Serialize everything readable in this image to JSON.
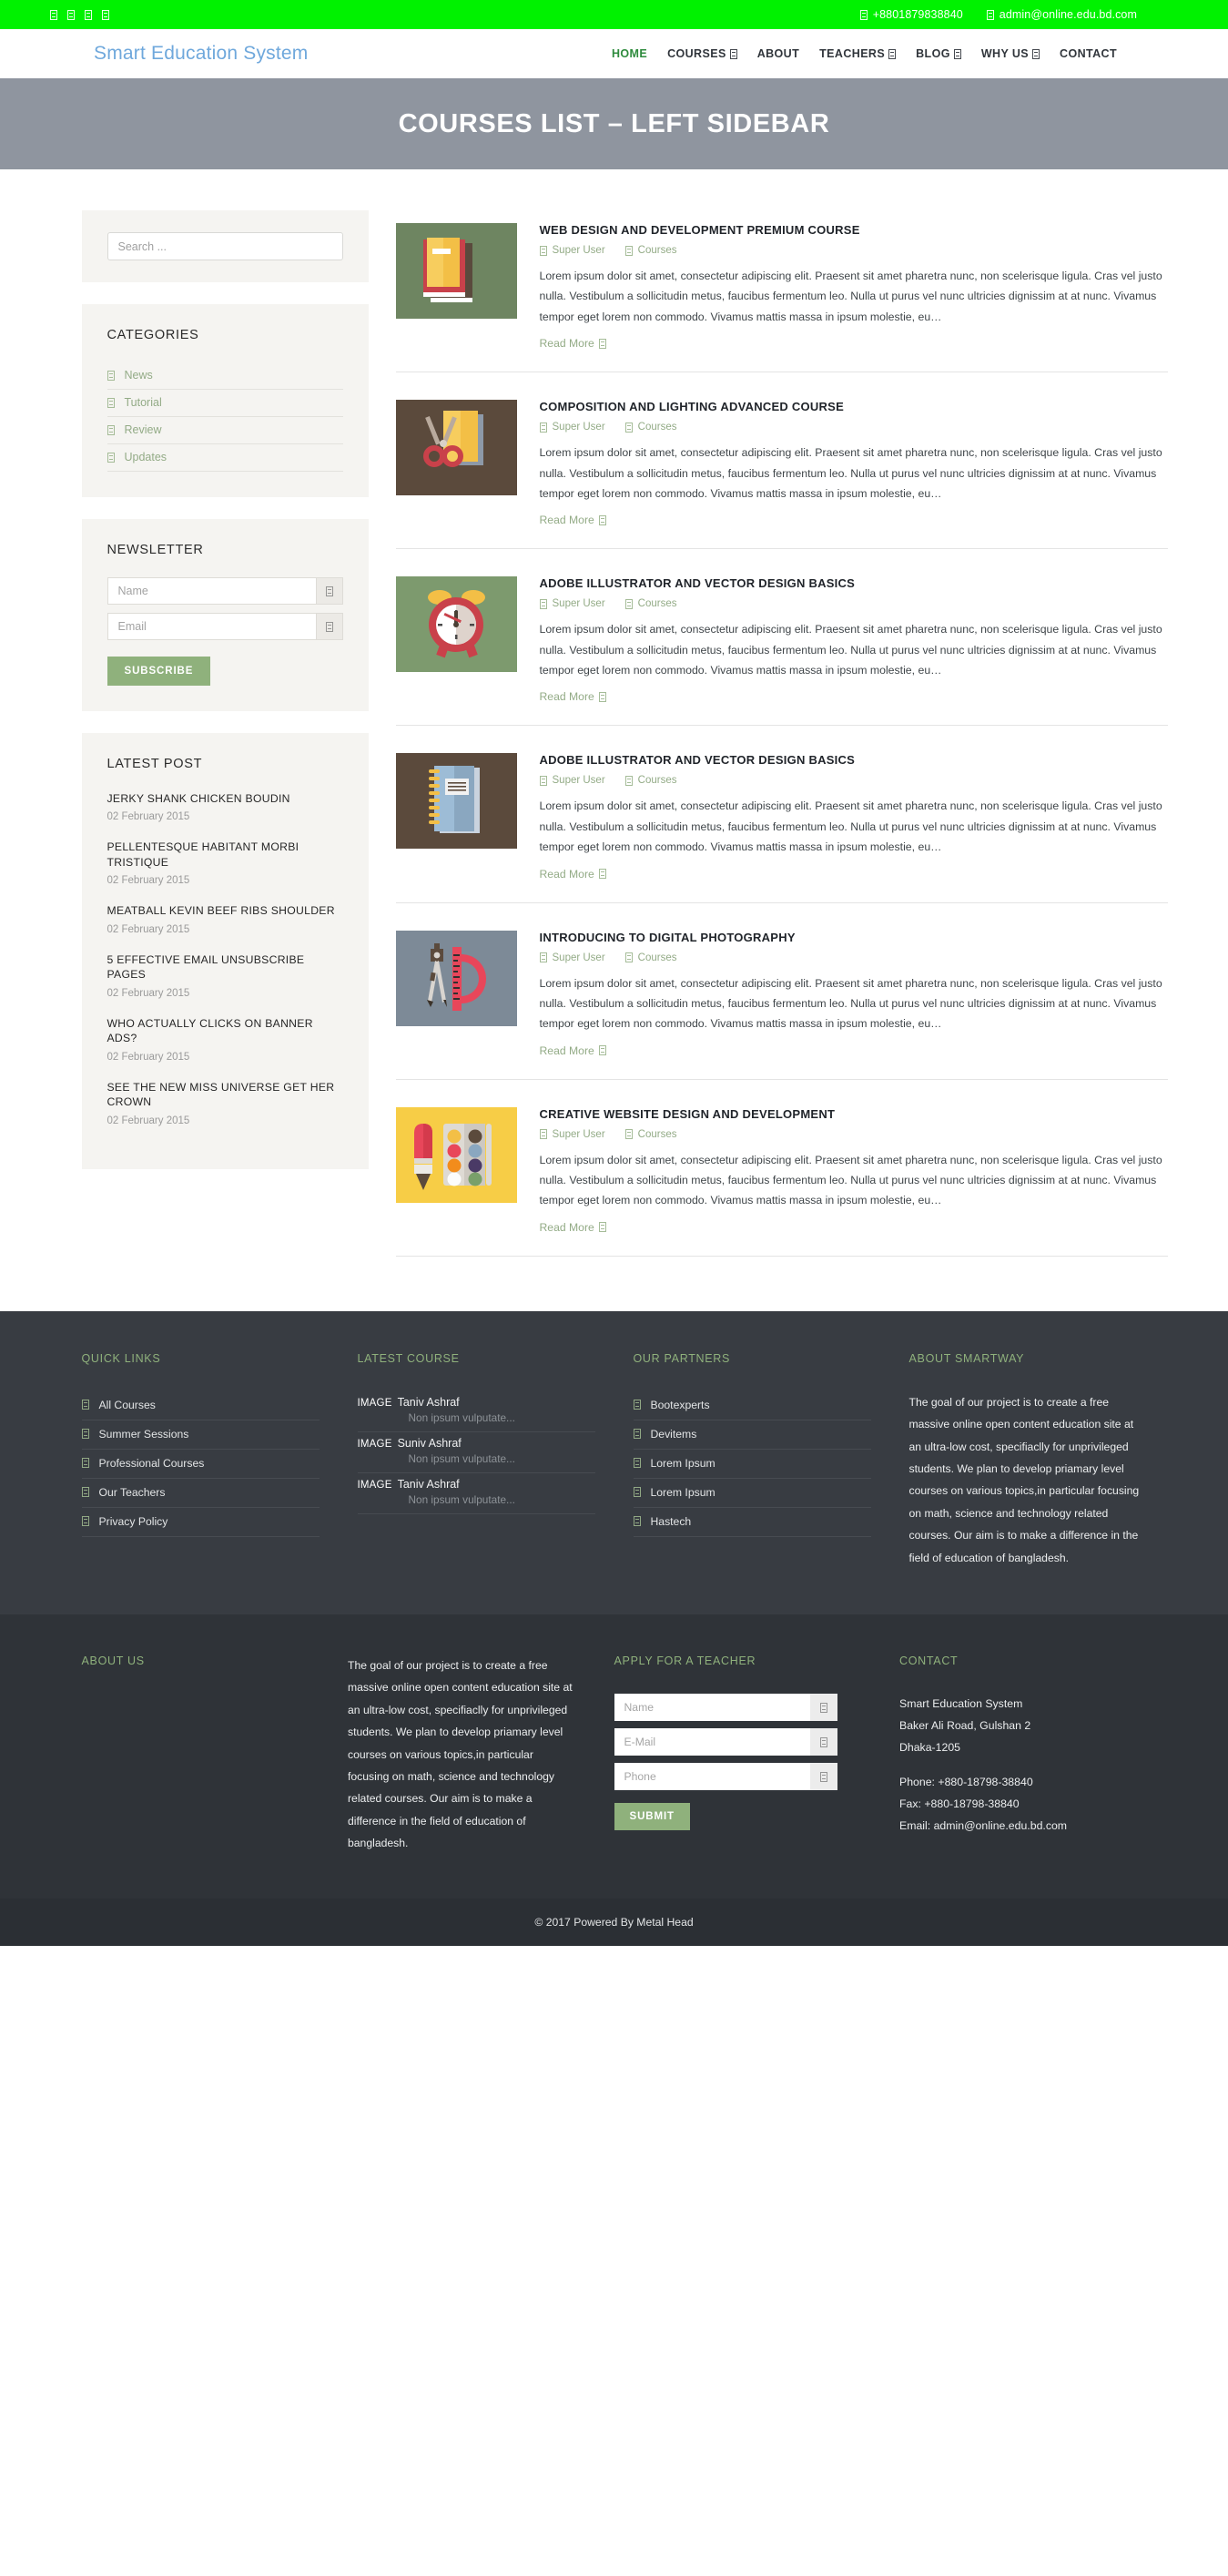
{
  "topbar": {
    "social_icons": [
      "facebook-icon",
      "twitter-icon",
      "google-plus-icon",
      "linkedin-icon"
    ],
    "phone_icon": "phone-icon",
    "phone": "+8801879838840",
    "email_icon": "envelope-icon",
    "email": "admin@online.edu.bd.com",
    "bg_color": "#00f200"
  },
  "header": {
    "logo": "Smart Education System",
    "logo_color": "#6fa8dc",
    "nav": [
      {
        "label": "HOME",
        "active": true,
        "caret": false
      },
      {
        "label": "COURSES",
        "active": false,
        "caret": true
      },
      {
        "label": "ABOUT",
        "active": false,
        "caret": false
      },
      {
        "label": "TEACHERS",
        "active": false,
        "caret": true
      },
      {
        "label": "BLOG",
        "active": false,
        "caret": true
      },
      {
        "label": "WHY US",
        "active": false,
        "caret": true
      },
      {
        "label": "CONTACT",
        "active": false,
        "caret": false
      }
    ]
  },
  "banner": {
    "title": "COURSES LIST – LEFT SIDEBAR",
    "bg_color": "#8f959f"
  },
  "sidebar": {
    "search": {
      "placeholder": "Search ...",
      "value": ""
    },
    "categories": {
      "title": "CATEGORIES",
      "items": [
        "News",
        "Tutorial",
        "Review",
        "Updates"
      ]
    },
    "newsletter": {
      "title": "NEWSLETTER",
      "name_placeholder": "Name",
      "email_placeholder": "Email",
      "name_value": "",
      "email_value": "",
      "subscribe_label": "SUBSCRIBE",
      "button_color": "#8fb17c"
    },
    "latest_post": {
      "title": "LATEST POST",
      "items": [
        {
          "title": "JERKY SHANK CHICKEN BOUDIN",
          "date": "02 February 2015"
        },
        {
          "title": "PELLENTESQUE HABITANT MORBI TRISTIQUE",
          "date": "02 February 2015"
        },
        {
          "title": "MEATBALL KEVIN BEEF RIBS SHOULDER",
          "date": "02 February 2015"
        },
        {
          "title": "5 EFFECTIVE EMAIL UNSUBSCRIBE PAGES",
          "date": "02 February 2015"
        },
        {
          "title": "WHO ACTUALLY CLICKS ON BANNER ADS?",
          "date": "02 February 2015"
        },
        {
          "title": "SEE THE NEW MISS UNIVERSE GET HER CROWN",
          "date": "02 February 2015"
        }
      ]
    }
  },
  "courses": {
    "excerpt": "Lorem ipsum dolor sit amet, consectetur adipiscing elit. Praesent sit amet pharetra nunc, non scelerisque ligula. Cras vel justo nulla. Vestibulum a sollicitudin metus, faucibus fermentum leo. Nulla ut purus vel nunc ultricies dignissim at at nunc. Vivamus tempor eget lorem non commodo. Vivamus mattis massa in ipsum molestie, eu…",
    "author_label": "Super User",
    "category_label": "Courses",
    "read_more_label": "Read More",
    "items": [
      {
        "title": "WEB DESIGN AND DEVELOPMENT PREMIUM COURSE",
        "thumb": "books-illustration",
        "thumb_bg": "#6e8561"
      },
      {
        "title": "COMPOSITION AND LIGHTING ADVANCED COURSE",
        "thumb": "scissors-paper-illustration",
        "thumb_bg": "#5b4a3c"
      },
      {
        "title": "ADOBE ILLUSTRATOR AND VECTOR DESIGN BASICS",
        "thumb": "alarm-clock-illustration",
        "thumb_bg": "#7d9a6e"
      },
      {
        "title": "ADOBE ILLUSTRATOR AND VECTOR DESIGN BASICS",
        "thumb": "notebook-illustration",
        "thumb_bg": "#5b4a3c"
      },
      {
        "title": "INTRODUCING TO DIGITAL PHOTOGRAPHY",
        "thumb": "compass-protractor-illustration",
        "thumb_bg": "#7d8a97"
      },
      {
        "title": "CREATIVE WEBSITE DESIGN AND DEVELOPMENT",
        "thumb": "paint-palette-illustration",
        "thumb_bg": "#f7cd46"
      }
    ]
  },
  "footer": {
    "accent_color": "#8fb17c",
    "quick_links": {
      "title": "QUICK LINKS",
      "items": [
        "All Courses",
        "Summer Sessions",
        "Professional Courses",
        "Our Teachers",
        "Privacy Policy"
      ]
    },
    "latest_course": {
      "title": "LATEST COURSE",
      "items": [
        {
          "image_label": "IMAGE",
          "name": "Taniv Ashraf",
          "desc": "Non ipsum vulputate..."
        },
        {
          "image_label": "IMAGE",
          "name": "Suniv Ashraf",
          "desc": "Non ipsum vulputate..."
        },
        {
          "image_label": "IMAGE",
          "name": "Taniv Ashraf",
          "desc": "Non ipsum vulputate..."
        }
      ]
    },
    "partners": {
      "title": "OUR PARTNERS",
      "items": [
        "Bootexperts",
        "Devitems",
        "Lorem Ipsum",
        "Lorem Ipsum",
        "Hastech"
      ]
    },
    "about_smartway": {
      "title": "ABOUT SMARTWAY",
      "text": "The goal of our project is to create a free massive online open content education site at an ultra-low cost, specifiaclly for unprivileged students. We plan to develop priamary level courses on various topics,in particular focusing on math, science and technology related courses. Our aim is to make a difference in the field of education of bangladesh."
    },
    "about_us": {
      "title": "ABOUT US",
      "text": "The goal of our project is to create a free massive online open content education site at an ultra-low cost, specifiaclly for unprivileged students. We plan to develop priamary level courses on various topics,in particular focusing on math, science and technology related courses. Our aim is to make a difference in the field of education of bangladesh."
    },
    "apply": {
      "title": "APPLY FOR A TEACHER",
      "name_placeholder": "Name",
      "email_placeholder": "E-Mail",
      "phone_placeholder": "Phone",
      "name_value": "",
      "email_value": "",
      "phone_value": "",
      "submit_label": "SUBMIT"
    },
    "contact": {
      "title": "CONTACT",
      "org": "Smart Education System",
      "address1": "Baker Ali Road, Gulshan 2",
      "address2": "Dhaka-1205",
      "phone": "Phone: +880-18798-38840",
      "fax": "Fax: +880-18798-38840",
      "email": "Email: admin@online.edu.bd.com"
    },
    "copyright": "© 2017 Powered By Metal Head"
  }
}
